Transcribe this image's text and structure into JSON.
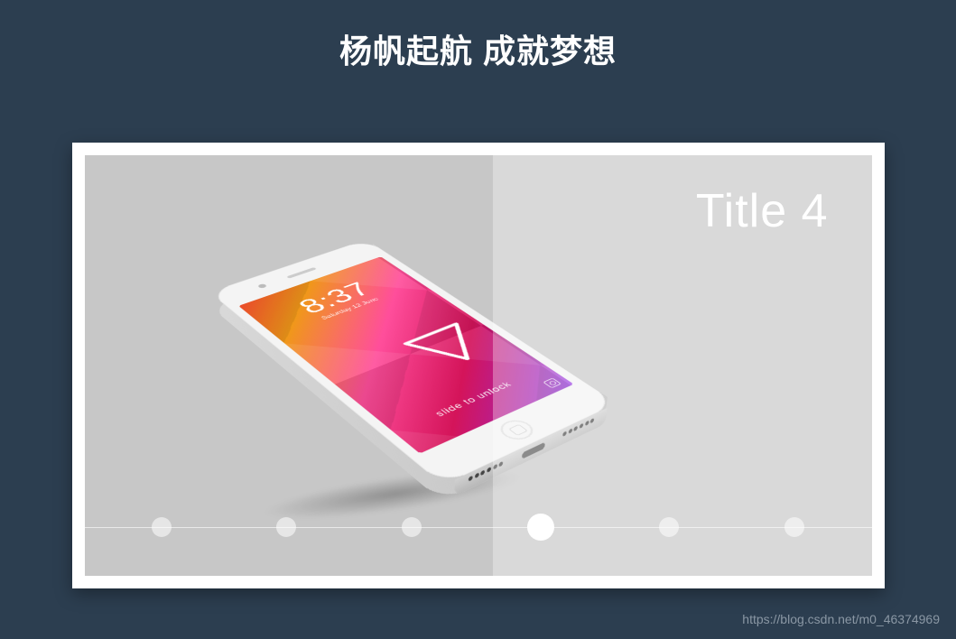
{
  "heading": "杨帆起航 成就梦想",
  "slide": {
    "overlay_title": "Title 4",
    "clock_time": "8:37",
    "clock_date": "Saturday 12 June",
    "slide_to_unlock": "slide to unlock"
  },
  "pager": {
    "count": 6,
    "active_index": 3
  },
  "watermark": "https://blog.csdn.net/m0_46374969"
}
